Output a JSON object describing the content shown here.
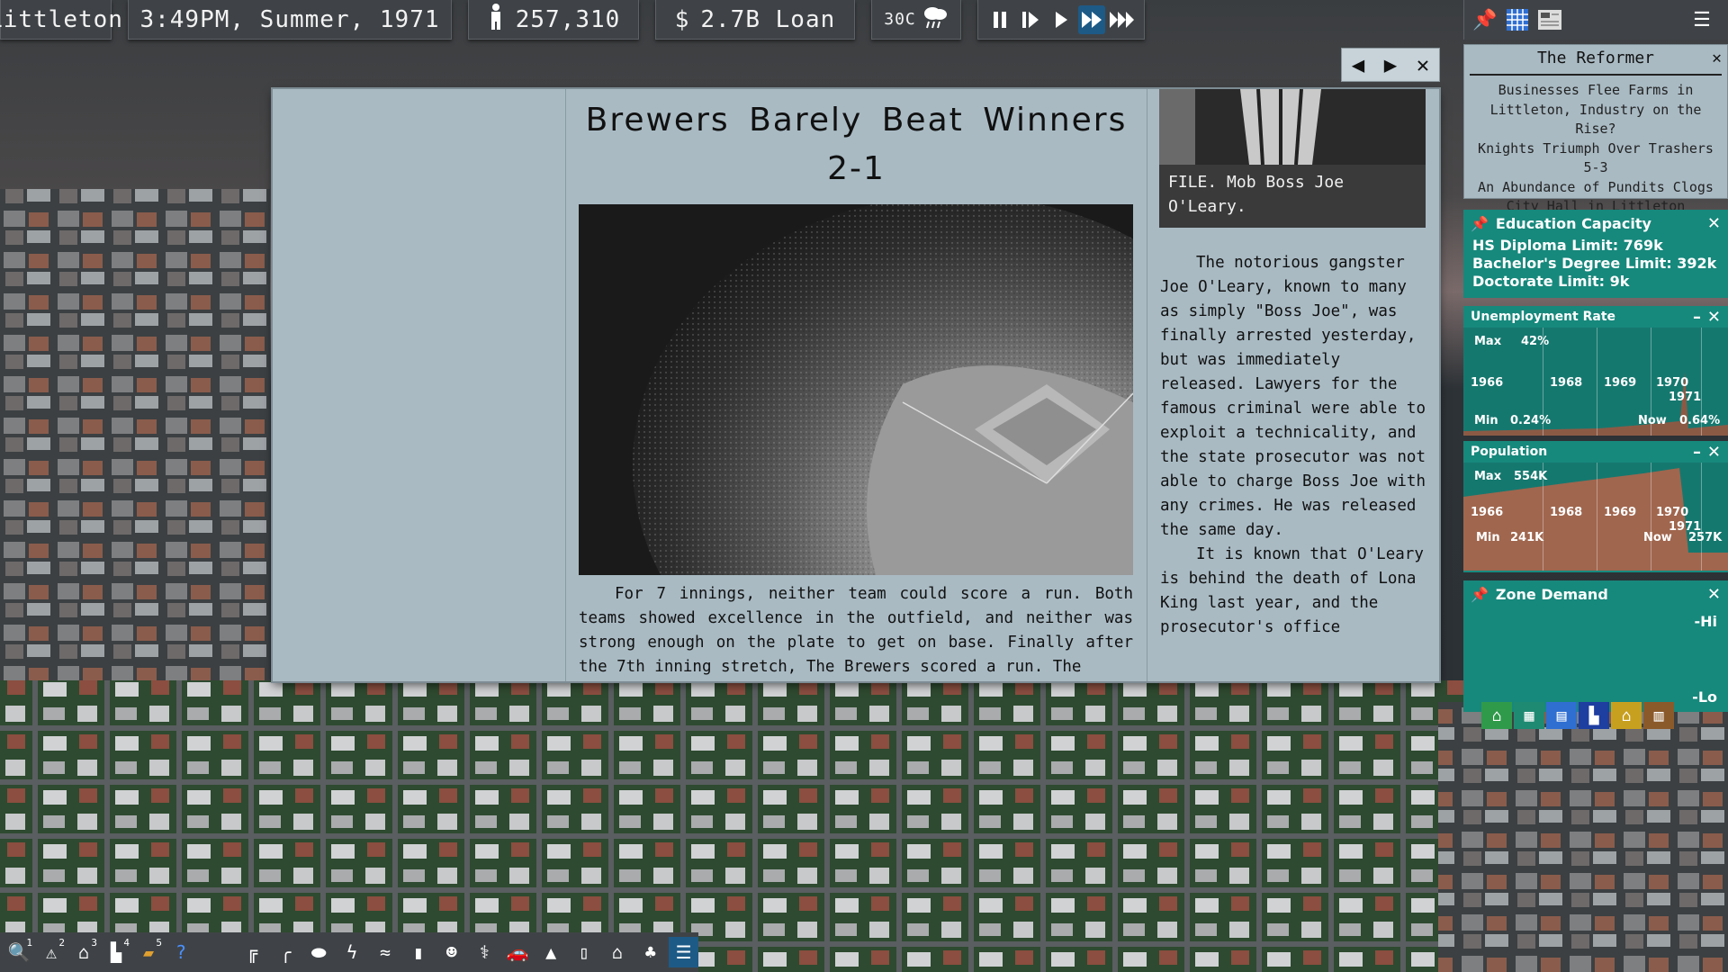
{
  "topbar": {
    "city_name": "Littleton",
    "datetime": "3:49PM, Summer, 1971",
    "population": "257,310",
    "money": "2.7B Loan",
    "money_symbol": "$",
    "weather_temp": "30C",
    "speed_buttons": [
      "pause-icon",
      "step-icon",
      "play-icon",
      "fast-icon",
      "fastest-icon"
    ],
    "active_speed": "fast-icon"
  },
  "newspaper": {
    "headline": "Brewers Barely Beat Winners 2-1",
    "article1": "For 7 innings, neither team could score a run. Both teams showed excellence in the outfield, and neither was strong enough on the plate to get on base. Finally after the 7th inning stretch, The Brewers scored a run. The",
    "file_caption": "FILE. Mob Boss Joe O'Leary.",
    "article2_p1": "The notorious gangster Joe O'Leary, known to many as simply \"Boss Joe\", was finally arrested yesterday, but was immediately released. Lawyers for the famous criminal were able to exploit a technicality, and the state prosecutor was not able to charge Boss Joe with any crimes. He was released the same day.",
    "article2_p2": "It is known that O'Leary is behind the death of Lona King last year, and the prosecutor's office"
  },
  "reformer": {
    "title": "The Reformer",
    "headlines": [
      "Businesses Flee Farms in Littleton, Industry on the Rise?",
      "Knights Triumph Over Trashers 5-3",
      "An Abundance of Pundits Clogs City Hall in Littleton"
    ]
  },
  "education": {
    "title": "Education Capacity",
    "hs": "HS Diploma Limit: 769k",
    "bachelor": "Bachelor's Degree Limit: 392k",
    "doctorate": "Doctorate Limit: 9k"
  },
  "unemployment": {
    "title": "Unemployment Rate",
    "max_label": "Max",
    "max_value": "42%",
    "min_label": "Min",
    "min_value": "0.24%",
    "now_label": "Now",
    "now_value": "0.64%",
    "years": [
      "1966",
      "1968",
      "1969",
      "1970",
      "1971"
    ]
  },
  "population_graph": {
    "title": "Population",
    "max_label": "Max",
    "max_value": "554K",
    "min_label": "Min",
    "min_value": "241K",
    "now_label": "Now",
    "now_value": "257K",
    "years": [
      "1966",
      "1968",
      "1969",
      "1970",
      "1971"
    ]
  },
  "zone_demand": {
    "title": "Zone Demand",
    "hi": "-Hi",
    "lo": "-Lo"
  },
  "bottom_toolbar": {
    "left_tools": [
      {
        "icon": "query-icon",
        "badge": "1"
      },
      {
        "icon": "hazard-icon",
        "badge": "2"
      },
      {
        "icon": "house-icon",
        "badge": "3"
      },
      {
        "icon": "factory-icon",
        "badge": "4"
      },
      {
        "icon": "bulldozer-icon",
        "badge": "5"
      },
      {
        "icon": "help-icon",
        "badge": ""
      }
    ],
    "right_tools": [
      "road-icon",
      "rail-icon",
      "pipe-icon",
      "power-icon",
      "water-icon",
      "monument-icon",
      "people-icon",
      "health-icon",
      "vehicle-icon",
      "traffic-cone-icon",
      "transit-icon",
      "residential-icon",
      "park-icon",
      "newspaper-icon"
    ]
  }
}
